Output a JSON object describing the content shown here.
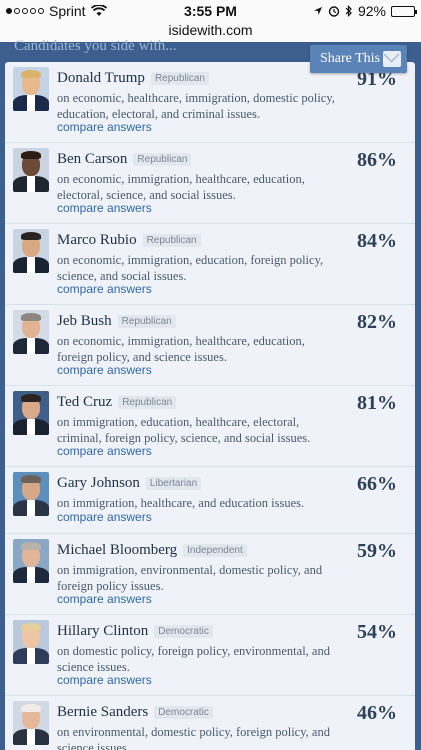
{
  "status_bar": {
    "carrier": "Sprint",
    "time": "3:55 PM",
    "battery": "92%"
  },
  "browser": {
    "url": "isidewith.com"
  },
  "section_title": "Candidates you side with...",
  "share": {
    "label": "Share This"
  },
  "compare_label": "compare answers",
  "candidates": [
    {
      "name": "Donald Trump",
      "party": "Republican",
      "issues": "on economic, healthcare, immigration, domestic policy, education, electoral, and criminal issues.",
      "percent": "91%"
    },
    {
      "name": "Ben Carson",
      "party": "Republican",
      "issues": "on economic, immigration, healthcare, education, electoral, science, and social issues.",
      "percent": "86%"
    },
    {
      "name": "Marco Rubio",
      "party": "Republican",
      "issues": "on economic, immigration, education, foreign policy, science, and social issues.",
      "percent": "84%"
    },
    {
      "name": "Jeb Bush",
      "party": "Republican",
      "issues": "on economic, immigration, healthcare, education, foreign policy, and science issues.",
      "percent": "82%"
    },
    {
      "name": "Ted Cruz",
      "party": "Republican",
      "issues": "on immigration, education, healthcare, electoral, criminal, foreign policy, science, and social issues.",
      "percent": "81%"
    },
    {
      "name": "Gary Johnson",
      "party": "Libertarian",
      "issues": "on immigration, healthcare, and education issues.",
      "percent": "66%"
    },
    {
      "name": "Michael Bloomberg",
      "party": "Independent",
      "issues": "on immigration, environmental, domestic policy, and foreign policy issues.",
      "percent": "59%"
    },
    {
      "name": "Hillary Clinton",
      "party": "Democratic",
      "issues": "on domestic policy, foreign policy, environmental, and science issues.",
      "percent": "54%"
    },
    {
      "name": "Bernie Sanders",
      "party": "Democratic",
      "issues": "on environmental, domestic policy, foreign policy, and science issues.",
      "percent": "46%"
    }
  ]
}
